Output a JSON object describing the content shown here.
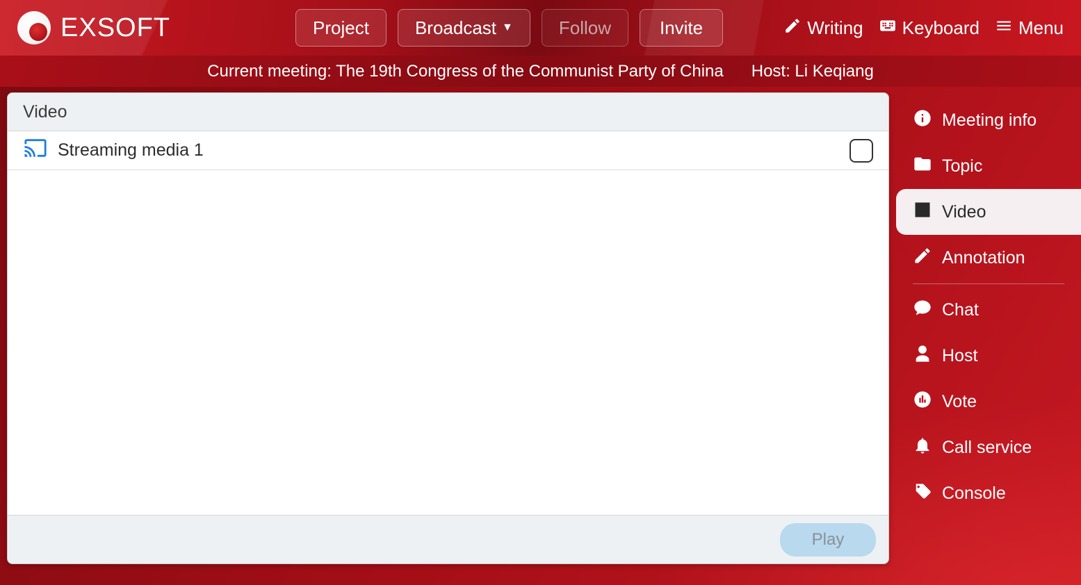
{
  "brand": {
    "name": "EXSOFT"
  },
  "header": {
    "buttons": {
      "project": "Project",
      "broadcast": "Broadcast",
      "follow": "Follow",
      "invite": "Invite"
    },
    "right": {
      "writing": "Writing",
      "keyboard": "Keyboard",
      "menu": "Menu"
    }
  },
  "infobar": {
    "meeting_label": "Current meeting: The 19th Congress of the Communist Party of China",
    "host_label": "Host: Li Keqiang"
  },
  "panel": {
    "title": "Video",
    "items": [
      {
        "label": "Streaming media 1",
        "checked": false
      }
    ],
    "play": "Play"
  },
  "sidebar": {
    "items": [
      {
        "key": "meeting-info",
        "label": "Meeting info",
        "icon": "info",
        "active": false
      },
      {
        "key": "topic",
        "label": "Topic",
        "icon": "folder",
        "active": false
      },
      {
        "key": "video",
        "label": "Video",
        "icon": "film",
        "active": true
      },
      {
        "key": "annotation",
        "label": "Annotation",
        "icon": "edit",
        "active": false
      },
      {
        "key": "chat",
        "label": "Chat",
        "icon": "chat",
        "active": false
      },
      {
        "key": "host",
        "label": "Host",
        "icon": "person",
        "active": false
      },
      {
        "key": "vote",
        "label": "Vote",
        "icon": "chart",
        "active": false
      },
      {
        "key": "call-service",
        "label": "Call service",
        "icon": "bell",
        "active": false
      },
      {
        "key": "console",
        "label": "Console",
        "icon": "tag",
        "active": false
      }
    ]
  }
}
